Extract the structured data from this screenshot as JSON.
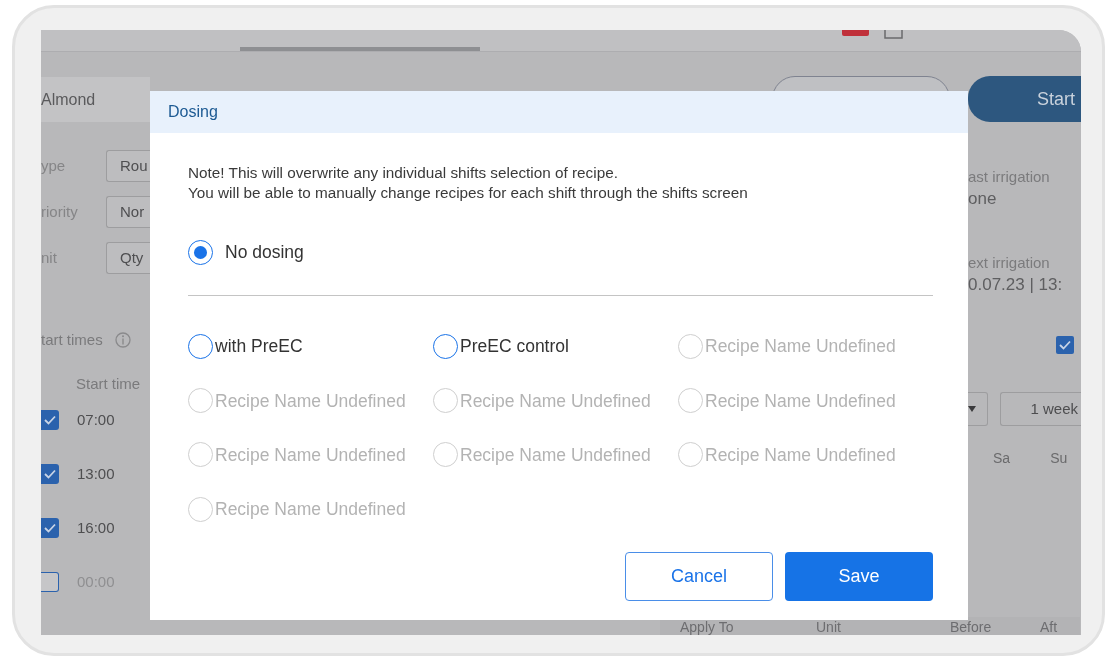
{
  "background": {
    "header_name": "Almond",
    "form": [
      {
        "label": "ype",
        "value": "Rou"
      },
      {
        "label": "riority",
        "value": "Nor"
      },
      {
        "label": "nit",
        "value": "Qty"
      }
    ],
    "start_times_label": "tart times",
    "start_time_header": "Start time",
    "start_times": [
      {
        "time": "07:00",
        "checked": true
      },
      {
        "time": "13:00",
        "checked": true
      },
      {
        "time": "16:00",
        "checked": true
      },
      {
        "time": "00:00",
        "checked": false
      }
    ],
    "start_button": "Start",
    "last_irrigation_label": "ast irrigation",
    "last_irrigation_value": "one",
    "next_irrigation_label": "ext irrigation",
    "next_irrigation_value": "0.07.23 | 13:",
    "repeat_checkbox": {
      "checked": true
    },
    "period": "1 week",
    "weekdays": [
      "Sa",
      "Su"
    ],
    "table_columns": [
      "Apply To",
      "Unit",
      "Before",
      "Aft"
    ]
  },
  "dialog": {
    "title": "Dosing",
    "note": [
      "Note! This will overwrite any individual shifts selection of recipe.",
      "You will be able to manually change recipes for each shift through the shifts screen"
    ],
    "no_dosing": {
      "label": "No dosing",
      "selected": true
    },
    "options": [
      {
        "label": "with PreEC",
        "selected": false,
        "disabled": false
      },
      {
        "label": "PreEC control",
        "selected": false,
        "disabled": false
      },
      {
        "label": "Recipe Name Undefined",
        "selected": false,
        "disabled": true
      },
      {
        "label": "Recipe Name Undefined",
        "selected": false,
        "disabled": true
      },
      {
        "label": "Recipe Name Undefined",
        "selected": false,
        "disabled": true
      },
      {
        "label": "Recipe Name Undefined",
        "selected": false,
        "disabled": true
      },
      {
        "label": "Recipe Name Undefined",
        "selected": false,
        "disabled": true
      },
      {
        "label": "Recipe Name Undefined",
        "selected": false,
        "disabled": true
      },
      {
        "label": "Recipe Name Undefined",
        "selected": false,
        "disabled": true
      },
      {
        "label": "Recipe Name Undefined",
        "selected": false,
        "disabled": true
      }
    ],
    "buttons": [
      {
        "label": "Cancel",
        "kind": "secondary"
      },
      {
        "label": "Save",
        "kind": "primary"
      }
    ]
  }
}
